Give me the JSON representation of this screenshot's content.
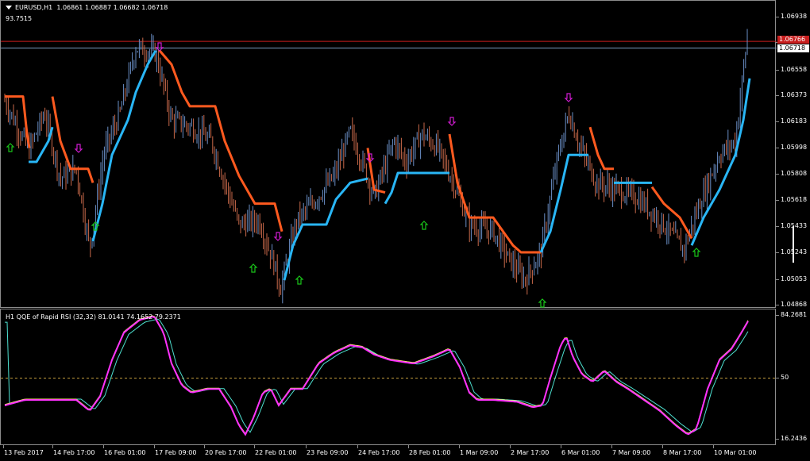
{
  "header": {
    "symbol": "EURUSD,H1",
    "open": "1.06861",
    "high": "1.06887",
    "low": "1.06682",
    "close": "1.06718",
    "sub_value": "93.7515"
  },
  "indicator": {
    "title": "H1 QQE of Rapid RSI (32,32) 81.0141 74.1652 79.2371"
  },
  "price_axis": {
    "labels": [
      "1.06938",
      "1.06753",
      "1.06558",
      "1.06373",
      "1.06183",
      "1.05998",
      "1.05808",
      "1.05618",
      "1.05433",
      "1.05243",
      "1.05053",
      "1.04868"
    ],
    "values": [
      1.06938,
      1.06753,
      1.06558,
      1.06373,
      1.06183,
      1.05998,
      1.05808,
      1.05618,
      1.05433,
      1.05243,
      1.05053,
      1.04868
    ],
    "red_line_label": "1.06766",
    "current_label": "1.06718",
    "red_line_value": 1.06766,
    "current_value": 1.06718
  },
  "indicator_axis": {
    "labels": [
      "84.2681",
      "50",
      "16.2436"
    ],
    "values": [
      84.2681,
      50,
      16.2436
    ]
  },
  "time_axis": {
    "labels": [
      "13 Feb 2017",
      "14 Feb 17:00",
      "16 Feb 01:00",
      "17 Feb 09:00",
      "20 Feb 17:00",
      "22 Feb 01:00",
      "23 Feb 09:00",
      "24 Feb 17:00",
      "28 Feb 01:00",
      "1 Mar 09:00",
      "2 Mar 17:00",
      "6 Mar 01:00",
      "7 Mar 09:00",
      "8 Mar 17:00",
      "10 Mar 01:00"
    ]
  },
  "colors": {
    "up_bars": "#6a8fc6",
    "down_bars": "#c8694a",
    "trail_up": "#29b6f6",
    "trail_down": "#ff5a1f",
    "arrow_up": "#19c419",
    "arrow_down": "#d01bd0",
    "red_line": "#c81e1e",
    "current_line": "#7a9cc0",
    "rsi_magenta": "#ff30ff",
    "rsi_yellow": "#ffff66",
    "rsi_cyan": "#4de0d0",
    "level_line": "#c8a040"
  }
}
